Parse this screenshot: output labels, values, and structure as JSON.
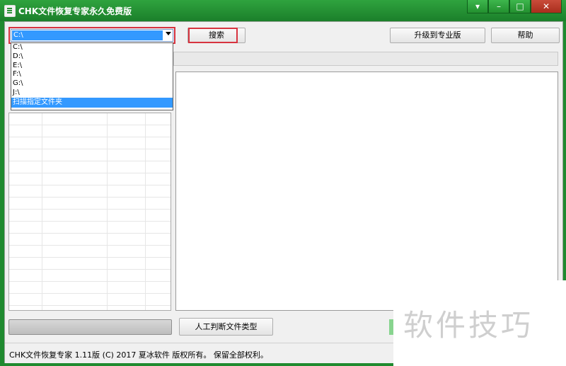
{
  "window": {
    "title": "CHK文件恢复专家永久免费版",
    "controls": {
      "help": "▾",
      "minimize": "–",
      "maximize": "□",
      "close": "✕"
    }
  },
  "toolbar": {
    "drive_selected": "C:\\",
    "search_label": "搜索",
    "upgrade_label": "升级到专业版",
    "help_label": "帮助"
  },
  "dropdown": {
    "items": [
      "C:\\",
      "D:\\",
      "E:\\",
      "F:\\",
      "G:\\",
      "J:\\",
      "扫描指定文件夹"
    ],
    "highlighted_index": 6
  },
  "actions": {
    "manual_type_label": "人工判断文件类型"
  },
  "progress": {
    "value": 0
  },
  "status": {
    "text": "CHK文件恢复专家 1.11版 (C) 2017 夏冰软件 版权所有。 保留全部权利。"
  },
  "overlay": {
    "watermark": "软件技巧"
  },
  "colors": {
    "title_green": "#1f8a2f",
    "highlight": "#3399ff",
    "annotation_red": "#d7333f"
  }
}
